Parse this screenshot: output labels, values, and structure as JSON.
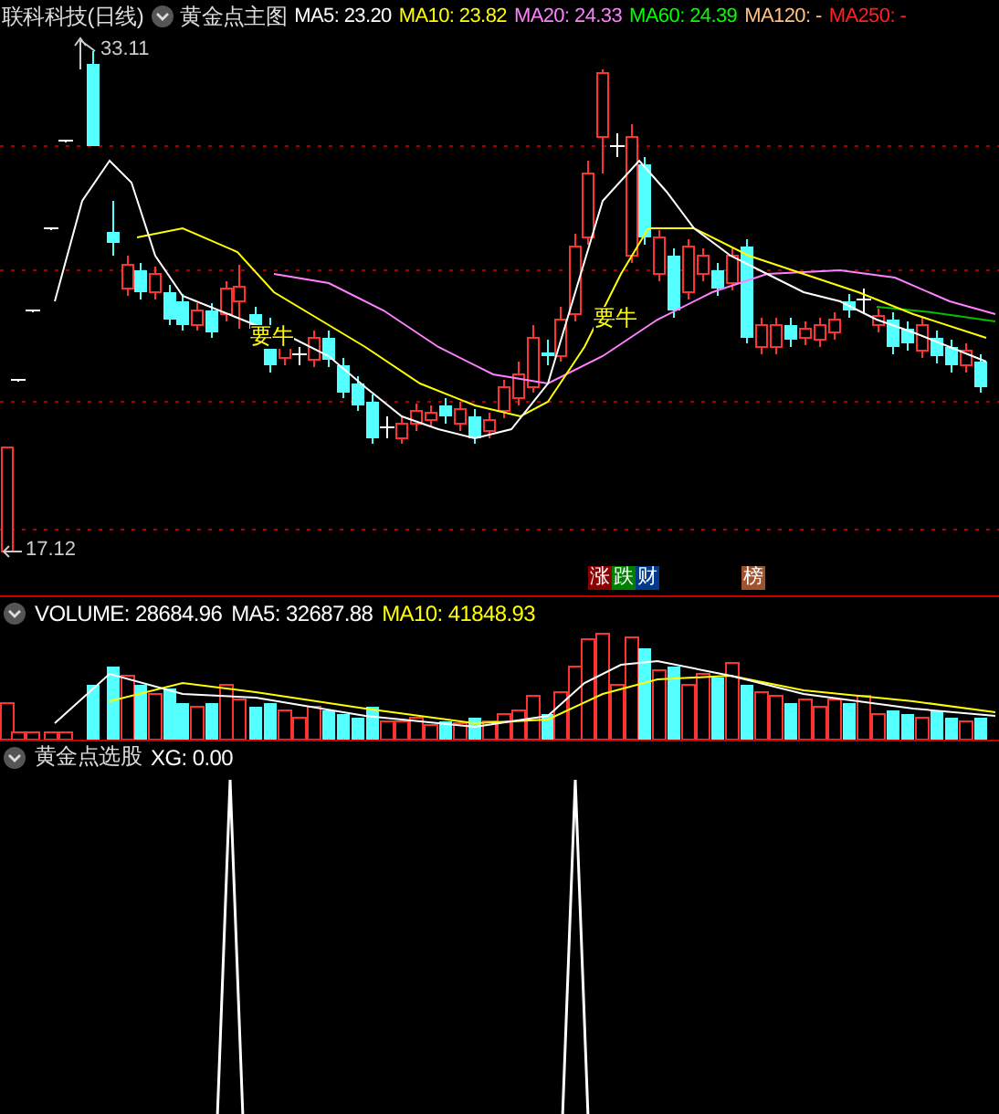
{
  "main_panel": {
    "stock_title": "联科科技(日线)",
    "indicator_name": "黄金点主图",
    "ma": [
      {
        "text": "MA5: 23.20",
        "color": "#ffffff"
      },
      {
        "text": "MA10: 23.82",
        "color": "#ffff00"
      },
      {
        "text": "MA20: 24.33",
        "color": "#ff80ff"
      },
      {
        "text": "MA60: 24.39",
        "color": "#00ff00"
      },
      {
        "text": "MA120: -",
        "color": "#ffc080"
      },
      {
        "text": "MA250: -",
        "color": "#ff2020"
      }
    ],
    "high_label": "33.11",
    "low_label": "17.12",
    "signals": [
      {
        "text": "要牛"
      },
      {
        "text": "要牛"
      }
    ],
    "badges": [
      {
        "text": "涨",
        "color": "#8b0000"
      },
      {
        "text": "跌",
        "color": "#008000"
      },
      {
        "text": "财",
        "color": "#003a8c"
      },
      {
        "text": "榜",
        "color": "#a0522d"
      }
    ]
  },
  "volume_panel": {
    "label": "VOLUME: 28684.96",
    "ma": [
      {
        "text": "MA5: 32687.88",
        "color": "#ffffff"
      },
      {
        "text": "MA10: 41848.93",
        "color": "#ffff00"
      }
    ]
  },
  "signal_panel": {
    "name": "黄金点选股",
    "value": "XG: 0.00"
  }
}
